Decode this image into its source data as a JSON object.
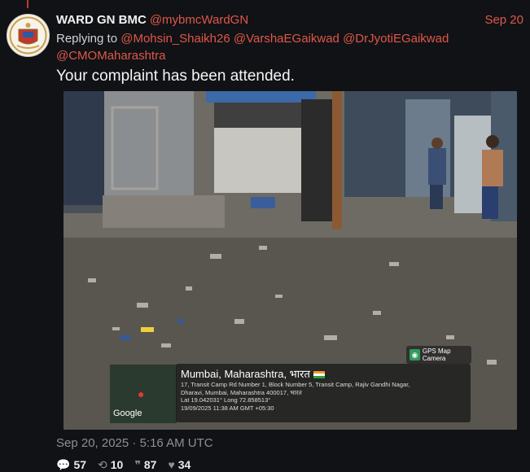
{
  "tweet": {
    "author_name": "WARD GN BMC",
    "author_handle": "@mybmcWardGN",
    "date": "Sep 20",
    "replying_to_label": "Replying to",
    "mentions": [
      "@Mohsin_Shaikh26",
      "@VarshaEGaikwad",
      "@DrJyotiEGaikwad",
      "@CMOMaharashtra"
    ],
    "text": "Your complaint has been attended.",
    "timestamp": "Sep 20, 2025 · 5:16 AM UTC",
    "stats": {
      "replies": "57",
      "retweets": "10",
      "quotes": "87",
      "likes": "34"
    },
    "colors": {
      "accent": "#e0574a",
      "background": "#111215"
    }
  },
  "photo_overlay": {
    "badge": "GPS Map Camera",
    "map_logo": "Google",
    "location_title": "Mumbai, Maharashtra, भारत",
    "address_line1": "17, Transit Camp Rd Number 1, Block Number 5, Transit Camp, Rajiv Gandhi Nagar,",
    "address_line2": "Dharavi, Mumbai, Maharashtra 400017, भारत",
    "coords": "Lat 19.042031° Long 72.858513°",
    "datetime": "19/09/2025 11:38 AM GMT +05:30"
  },
  "icons": {
    "reply": "reply-icon",
    "retweet": "retweet-icon",
    "quote": "quote-icon",
    "like": "heart-icon"
  }
}
